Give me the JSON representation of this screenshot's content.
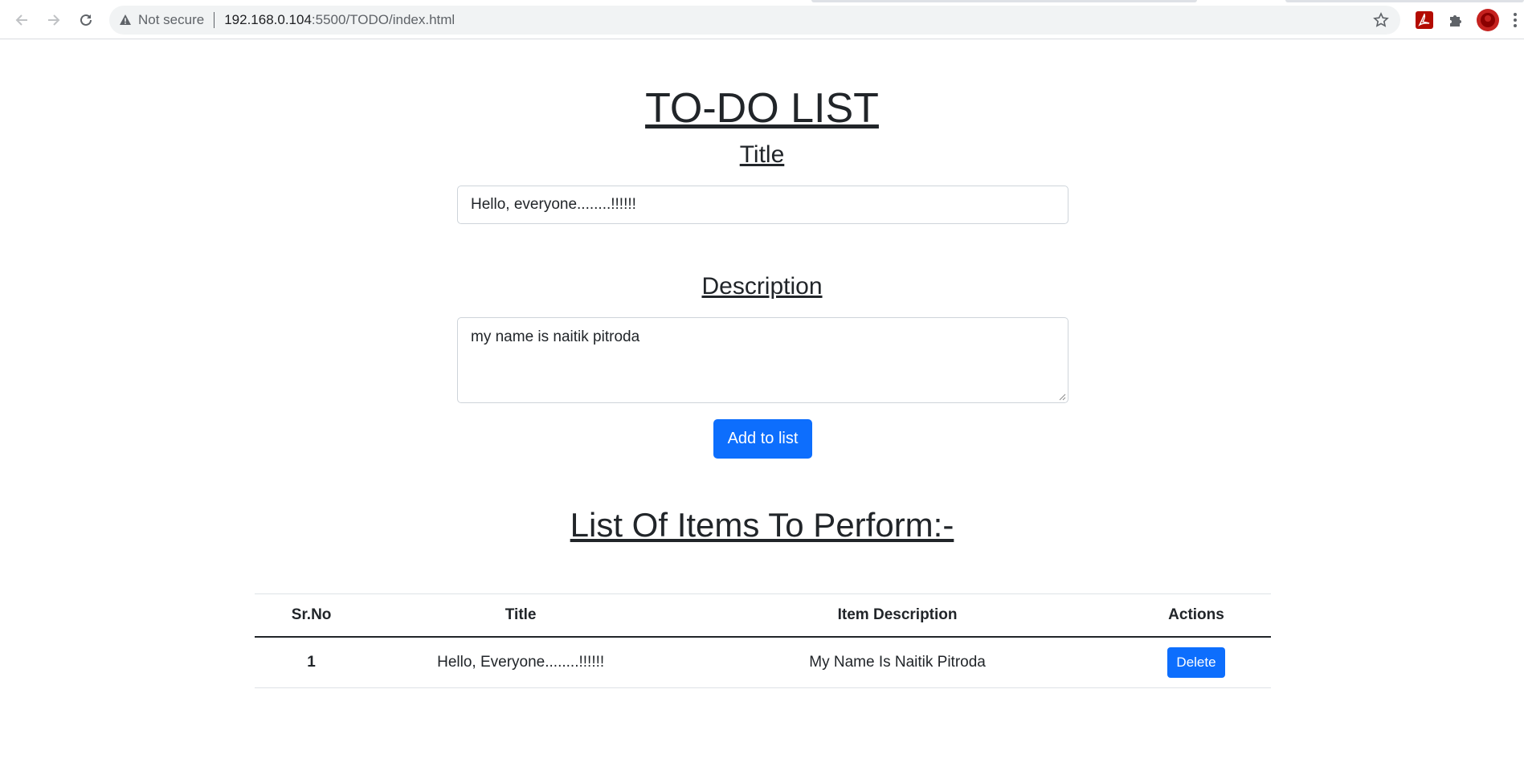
{
  "browser": {
    "security_label": "Not secure",
    "url_host": "192.168.0.104",
    "url_path": ":5500/TODO/index.html",
    "icons": [
      "back-icon",
      "forward-icon",
      "reload-icon",
      "warning-icon",
      "bookmark-star-icon",
      "acrobat-extension-icon",
      "extensions-puzzle-icon",
      "profile-avatar-icon",
      "menu-kebab-icon"
    ]
  },
  "page": {
    "heading": "TO-DO LIST",
    "title_label": "Title",
    "title_value": "Hello, everyone........!!!!!!",
    "description_label": "Description",
    "description_value": "my name is naitik pitroda",
    "add_button": "Add to list",
    "list_heading": "List Of Items To Perform:-"
  },
  "table": {
    "headers": [
      "Sr.No",
      "Title",
      "Item Description",
      "Actions"
    ],
    "rows": [
      {
        "srno": "1",
        "title": "Hello, Everyone........!!!!!!",
        "description": "My Name Is Naitik Pitroda",
        "action": "Delete"
      }
    ]
  },
  "colors": {
    "primary": "#0d6efd",
    "text": "#212529",
    "chrome_bg": "#f1f3f4"
  }
}
